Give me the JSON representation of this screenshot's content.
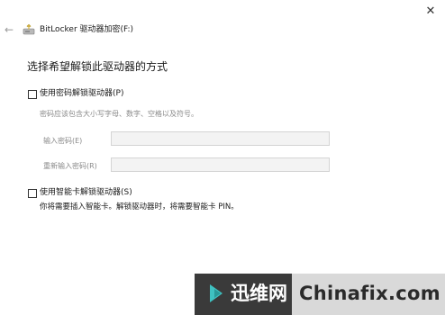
{
  "window": {
    "title": "BitLocker 驱动器加密(F:)",
    "back_icon": "back-arrow-icon",
    "app_icon": "bitlocker-drive-icon",
    "close_icon": "close-icon",
    "close_glyph": "✕",
    "back_glyph": "←"
  },
  "main": {
    "heading": "选择希望解锁此驱动器的方式",
    "password_option": {
      "label": "使用密码解锁驱动器(P)",
      "checked": false,
      "hint": "密码应该包含大小写字母、数字、空格以及符号。",
      "enter_label": "输入密码(E)",
      "reenter_label": "重新输入密码(R)",
      "enter_value": "",
      "reenter_value": ""
    },
    "smartcard_option": {
      "label": "使用智能卡解锁驱动器(S)",
      "checked": false,
      "description": "你将需要插入智能卡。解锁驱动器时，将需要智能卡 PIN。"
    }
  },
  "watermark": {
    "brand_cn": "迅维网",
    "brand_en": "Chinafix.com",
    "colors": {
      "dark": "#3a3a3a",
      "accent": "#3fc2c2"
    }
  }
}
